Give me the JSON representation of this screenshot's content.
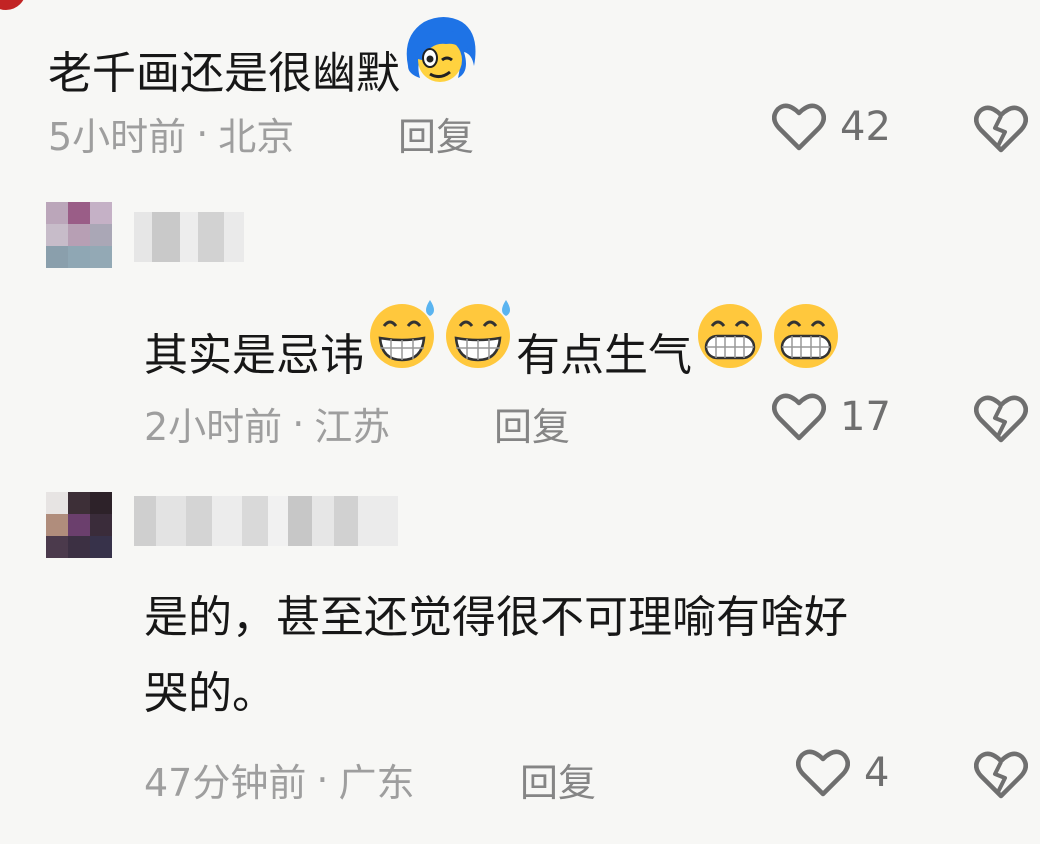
{
  "comments": [
    {
      "text": "老千画还是很幽默",
      "emoji_after": [
        "blue-hair-face-emoji"
      ],
      "time": "5小时前",
      "location": "北京",
      "reply_label": "回复",
      "likes": "42"
    },
    {
      "text_before": "其实是忌讳",
      "emoji_mid": [
        "grinning-sweat-emoji",
        "grinning-sweat-emoji"
      ],
      "text_after": "有点生气",
      "emoji_after": [
        "grimacing-emoji",
        "grimacing-emoji"
      ],
      "time": "2小时前",
      "location": "江苏",
      "reply_label": "回复",
      "likes": "17"
    },
    {
      "line1": "是的，甚至还觉得很不可理喻有啥好",
      "line2": "哭的。",
      "time": "47分钟前",
      "location": "广东",
      "reply_label": "回复",
      "likes": "4"
    }
  ],
  "meta_separator": "·",
  "icons": {
    "like": "heart-outline-icon",
    "dislike": "broken-heart-icon"
  },
  "colors": {
    "background": "#f7f7f5",
    "text": "#171717",
    "meta": "#9e9e9e",
    "icon": "#6f6f6f"
  }
}
